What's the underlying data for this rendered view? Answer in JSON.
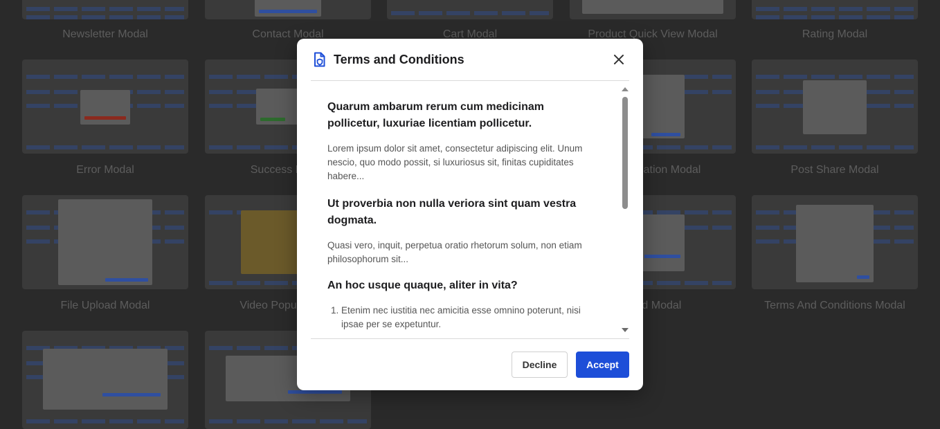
{
  "gallery": {
    "cards": [
      {
        "title": "Newsletter Modal"
      },
      {
        "title": "Contact Modal"
      },
      {
        "title": "Cart Modal"
      },
      {
        "title": "Product Quick View Modal"
      },
      {
        "title": "Rating Modal"
      },
      {
        "title": "Error Modal"
      },
      {
        "title": "Success Modal"
      },
      {
        "title": "Confirmation Modal"
      },
      {
        "title": "Post Share Modal"
      },
      {
        "title": "File Upload Modal"
      },
      {
        "title": "Video Popup Modal"
      },
      {
        "title": "Card Modal"
      },
      {
        "title": "Terms And Conditions Modal"
      }
    ]
  },
  "modal": {
    "title": "Terms and Conditions",
    "icon": "document-shield-icon",
    "accent_color": "#1d4ed8",
    "sections": [
      {
        "heading": "Quarum ambarum rerum cum medicinam pollicetur, luxuriae licentiam pollicetur.",
        "paragraph": "Lorem ipsum dolor sit amet, consectetur adipiscing elit. Unum nescio, quo modo possit, si luxuriosus sit, finitas cupiditates habere..."
      },
      {
        "heading": "Ut proverbia non nulla veriora sint quam vestra dogmata.",
        "paragraph": "Quasi vero, inquit, perpetua oratio rhetorum solum, non etiam philosophorum sit..."
      },
      {
        "heading": "An hoc usque quaque, aliter in vita?",
        "list": [
          "Etenim nec iustitia nec amicitia esse omnino poterunt, nisi ipsae per se expetuntur."
        ]
      }
    ],
    "buttons": {
      "decline": "Decline",
      "accept": "Accept"
    }
  }
}
